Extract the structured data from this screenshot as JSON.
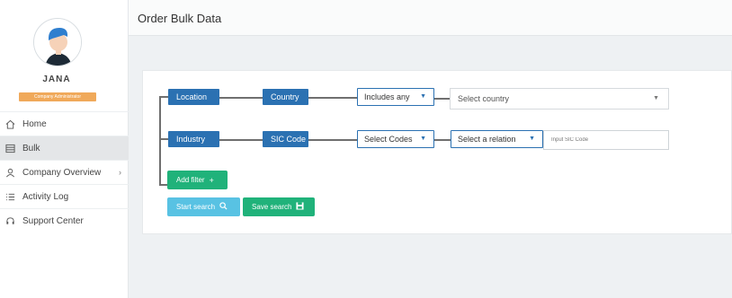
{
  "sidebar": {
    "username": "JANA",
    "role": "Company Administrator",
    "items": [
      {
        "label": "Home",
        "icon": "home-icon"
      },
      {
        "label": "Bulk",
        "icon": "bulk-icon"
      },
      {
        "label": "Company Overview",
        "icon": "user-icon",
        "has_submenu": true
      },
      {
        "label": "Activity Log",
        "icon": "list-icon"
      },
      {
        "label": "Support Center",
        "icon": "headset-icon"
      }
    ],
    "active_item": "Bulk"
  },
  "header": {
    "title": "Order Bulk Data"
  },
  "filters": {
    "row1": {
      "root": "Location",
      "field": "Country",
      "operator": "Includes any",
      "value_placeholder": "Select country"
    },
    "row2": {
      "root": "Industry",
      "field": "SIC Code",
      "mode": "Select Codes",
      "relation": "Select a relation",
      "input_placeholder": "Input SIC Code"
    }
  },
  "actions": {
    "add_filter": "Add filter",
    "start_search": "Start search",
    "save_search": "Save search"
  },
  "colors": {
    "chip_blue": "#2b71b2",
    "green": "#20b27a",
    "light_blue": "#58c2e3",
    "badge_orange": "#f0a95a"
  }
}
